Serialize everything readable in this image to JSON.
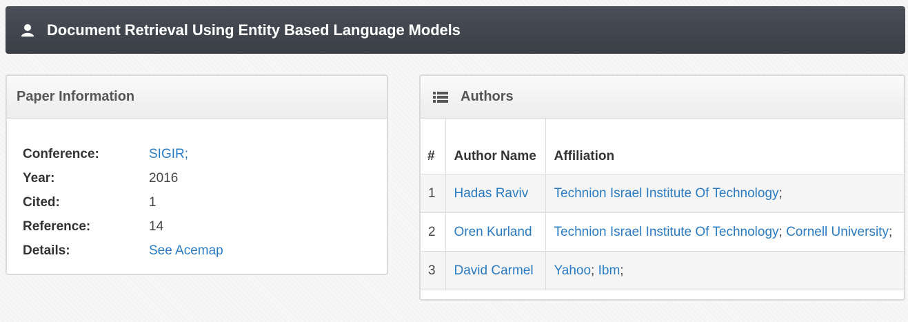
{
  "title_bar": {
    "title": "Document Retrieval Using Entity Based Language Models",
    "icon": "user-icon"
  },
  "paper_panel": {
    "heading": "Paper Information",
    "rows": [
      {
        "label": "Conference:",
        "value": "SIGIR;",
        "link": true
      },
      {
        "label": "Year:",
        "value": "2016",
        "link": false
      },
      {
        "label": "Cited:",
        "value": "1",
        "link": false
      },
      {
        "label": "Reference:",
        "value": "14",
        "link": false
      },
      {
        "label": "Details:",
        "value": "See Acemap",
        "link": true
      }
    ]
  },
  "authors_panel": {
    "heading": "Authors",
    "icon": "list-icon",
    "columns": [
      "#",
      "Author Name",
      "Affiliation"
    ],
    "rows": [
      {
        "num": "1",
        "name": "Hadas Raviv",
        "affiliations": [
          "Technion Israel Institute Of Technology"
        ]
      },
      {
        "num": "2",
        "name": "Oren Kurland",
        "affiliations": [
          "Technion Israel Institute Of Technology",
          "Cornell University"
        ]
      },
      {
        "num": "3",
        "name": "David Carmel",
        "affiliations": [
          "Yahoo",
          "Ibm"
        ]
      }
    ]
  },
  "colors": {
    "title_bar": "#3f434a",
    "link": "#2a7bc0",
    "panel_border": "#dadada"
  }
}
